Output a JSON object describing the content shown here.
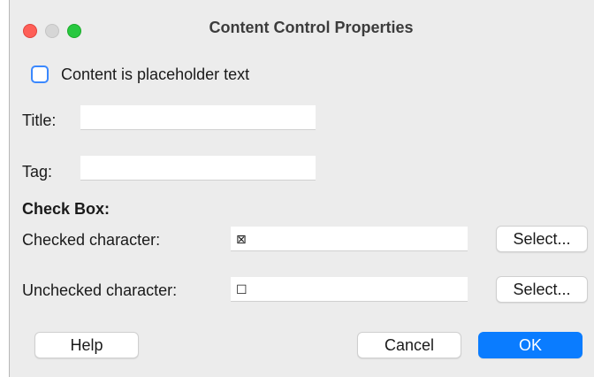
{
  "window": {
    "title": "Content Control Properties"
  },
  "placeholder_checkbox": {
    "label": "Content is placeholder text",
    "checked": false
  },
  "fields": {
    "title_label": "Title:",
    "title_value": "",
    "tag_label": "Tag:",
    "tag_value": ""
  },
  "check_box_section": {
    "heading": "Check Box:",
    "checked_label": "Checked character:",
    "checked_value": "⊠",
    "unchecked_label": "Unchecked character:",
    "unchecked_value": "☐",
    "select_label": "Select..."
  },
  "buttons": {
    "help": "Help",
    "cancel": "Cancel",
    "ok": "OK"
  },
  "colors": {
    "accent": "#0a7cff",
    "checkbox_border": "#3a88fe",
    "close": "#fe5f57",
    "minimize": "#d6d6d6",
    "maximize": "#28c840"
  }
}
